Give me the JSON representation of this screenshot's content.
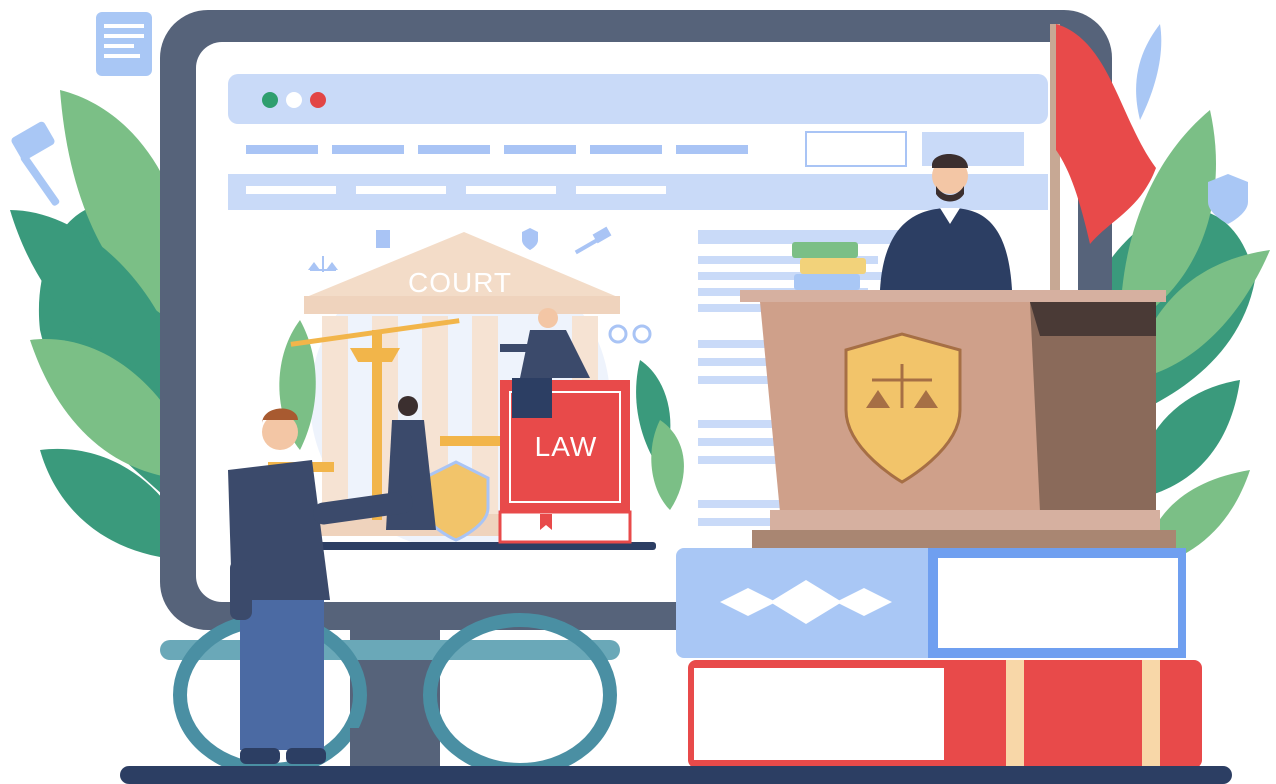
{
  "illustration": {
    "court_label": "COURT",
    "law_label": "LAW"
  },
  "browser": {
    "window_dots": [
      "#2e9e6e",
      "#ffffff",
      "#e24545"
    ]
  },
  "colors": {
    "monitor_frame": "#56637a",
    "screen_bg": "#ffffff",
    "browser_bar": "#c9daf8",
    "placeholder": "#a9c4f5",
    "leaf_dark": "#3a9a7c",
    "leaf_light": "#7bbf86",
    "flag": "#e84a4a",
    "podium": "#cfa08a",
    "podium_shadow": "#8a6a5a",
    "shield": "#f2c46a",
    "book_blue": "#a9c7f5",
    "book_red": "#e84a4a",
    "floor": "#2c3e63"
  },
  "icons": [
    "gavel-icon",
    "scroll-icon",
    "quill-icon",
    "shield-icon",
    "scales-icon",
    "handcuffs-icon"
  ]
}
